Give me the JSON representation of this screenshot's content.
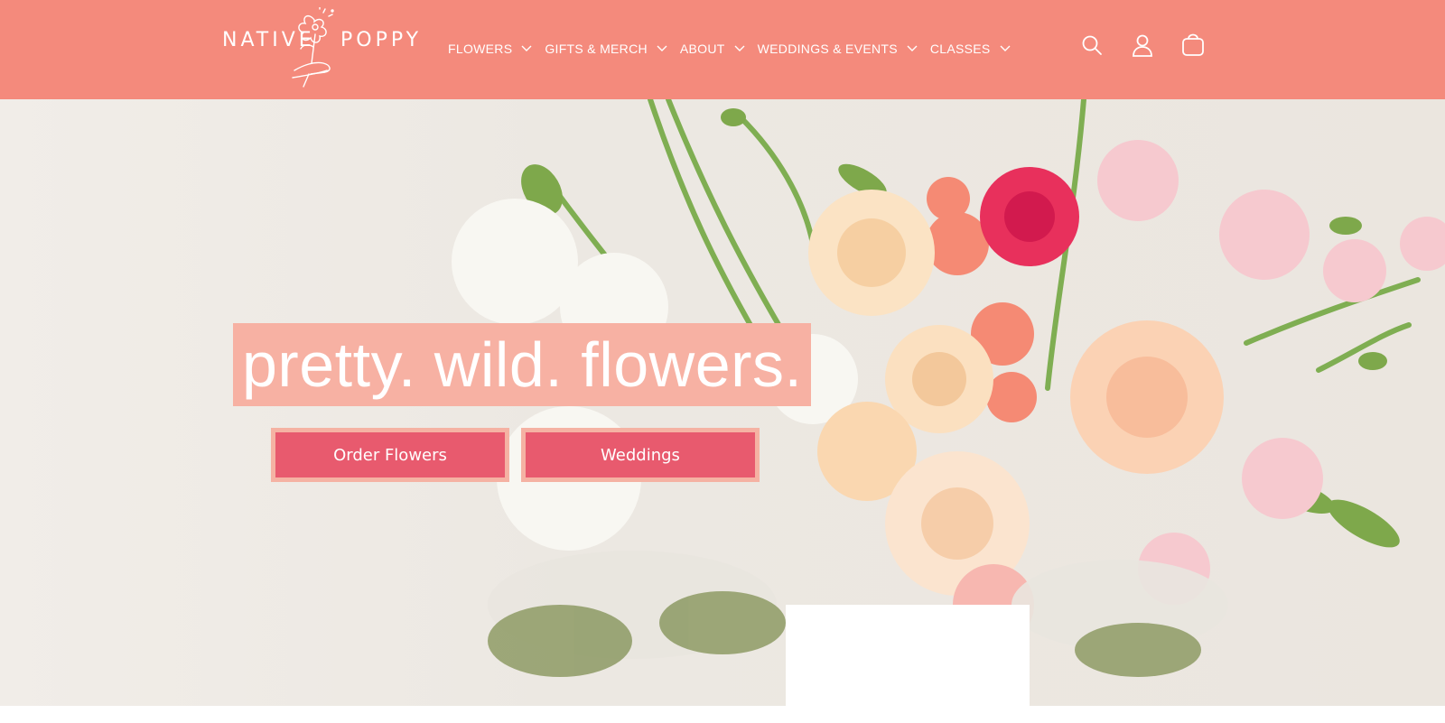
{
  "brand": {
    "logo_left": "NATIVE",
    "logo_right": "POPPY",
    "logo_icon": "hand-holding-flower-icon",
    "header_color": "#f48a7c"
  },
  "nav": {
    "items": [
      {
        "label": "FLOWERS"
      },
      {
        "label": "GIFTS & MERCH"
      },
      {
        "label": "ABOUT"
      },
      {
        "label": "WEDDINGS & EVENTS"
      },
      {
        "label": "CLASSES"
      }
    ]
  },
  "header_icons": [
    "search-icon",
    "account-icon",
    "cart-icon"
  ],
  "hero": {
    "headline": "pretty. wild. flowers.",
    "headline_bg": "#f7b1a3",
    "buttons": {
      "order": "Order Flowers",
      "weddings": "Weddings"
    },
    "button_color": "#e85a6e"
  }
}
